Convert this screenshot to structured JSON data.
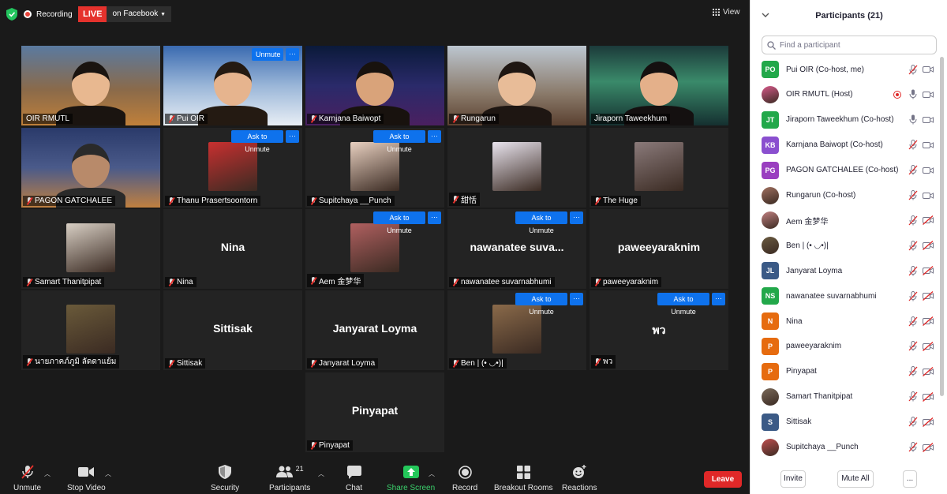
{
  "topbar": {
    "recording_label": "Recording",
    "live_label": "LIVE",
    "live_destination": "on Facebook",
    "view_label": "View"
  },
  "tiles": [
    {
      "name": "OIR RMUTL",
      "muted": false,
      "unmute": "",
      "more": false,
      "type": "video"
    },
    {
      "name": "Pui OIR",
      "muted": true,
      "unmute": "Unmute",
      "more": true,
      "type": "video"
    },
    {
      "name": "Karnjana Baiwopt",
      "muted": true,
      "unmute": "",
      "more": false,
      "type": "video"
    },
    {
      "name": "Rungarun",
      "muted": true,
      "unmute": "",
      "more": false,
      "type": "video"
    },
    {
      "name": "Jiraporn Taweekhum",
      "muted": false,
      "unmute": "",
      "more": false,
      "type": "video"
    },
    {
      "name": "PAGON GATCHALEE",
      "muted": true,
      "unmute": "",
      "more": false,
      "type": "video"
    },
    {
      "name": "Thanu Prasertsoontorn",
      "muted": true,
      "unmute": "Ask to Unmute",
      "more": true,
      "type": "photo"
    },
    {
      "name": "Supitchaya __Punch",
      "muted": true,
      "unmute": "Ask to Unmute",
      "more": true,
      "type": "photo"
    },
    {
      "name": "甜恬",
      "muted": true,
      "unmute": "",
      "more": false,
      "type": "photo"
    },
    {
      "name": "The Huge",
      "muted": true,
      "unmute": "",
      "more": false,
      "type": "photo"
    },
    {
      "name": "Samart Thanitpipat",
      "muted": true,
      "unmute": "",
      "more": false,
      "type": "photo"
    },
    {
      "name": "Nina",
      "muted": true,
      "unmute": "",
      "more": false,
      "type": "text",
      "center": "Nina"
    },
    {
      "name": "Aem 金梦华",
      "muted": true,
      "unmute": "Ask to Unmute",
      "more": true,
      "type": "photo"
    },
    {
      "name": "nawanatee suvarnabhumi",
      "muted": true,
      "unmute": "Ask to Unmute",
      "more": true,
      "type": "text",
      "center": "nawanatee  suva..."
    },
    {
      "name": "paweeyaraknim",
      "muted": true,
      "unmute": "",
      "more": false,
      "type": "text",
      "center": "paweeyaraknim"
    },
    {
      "name": "นายภาคภ์ภูมิ ลัดดาแย้ม",
      "muted": true,
      "unmute": "",
      "more": false,
      "type": "photo"
    },
    {
      "name": "Sittisak",
      "muted": true,
      "unmute": "",
      "more": false,
      "type": "text",
      "center": "Sittisak"
    },
    {
      "name": "Janyarat Loyma",
      "muted": true,
      "unmute": "",
      "more": false,
      "type": "text",
      "center": "Janyarat Loyma"
    },
    {
      "name": "Ben | (• ◡•)|",
      "muted": true,
      "unmute": "Ask to Unmute",
      "more": true,
      "type": "photo"
    },
    {
      "name": "พว",
      "muted": true,
      "unmute": "Ask to Unmute",
      "more": true,
      "type": "text",
      "center": "พว"
    },
    {
      "name": "Pinyapat",
      "muted": true,
      "unmute": "",
      "more": false,
      "type": "text",
      "center": "Pinyapat"
    }
  ],
  "more_glyph": "···",
  "toolbar": {
    "unmute": "Unmute",
    "stop_video": "Stop Video",
    "security": "Security",
    "participants": "Participants",
    "participants_count": "21",
    "chat": "Chat",
    "share_screen": "Share Screen",
    "record": "Record",
    "breakout_rooms": "Breakout Rooms",
    "reactions": "Reactions",
    "leave": "Leave"
  },
  "panel": {
    "title": "Participants (21)",
    "search_placeholder": "Find a participant",
    "participants": [
      {
        "initials": "PO",
        "name": "Pui OIR (Co-host, me)",
        "color": "#22a84a",
        "mic": "muted",
        "video": "on"
      },
      {
        "initials": "",
        "name": "OIR RMUTL (Host)",
        "color": "#d65a8a",
        "mic": "on",
        "video": "on",
        "recording": true
      },
      {
        "initials": "JT",
        "name": "Jiraporn Taweekhum (Co-host)",
        "color": "#22a84a",
        "mic": "on",
        "video": "on"
      },
      {
        "initials": "KB",
        "name": "Karnjana Baiwopt (Co-host)",
        "color": "#8a4fcf",
        "mic": "muted",
        "video": "on"
      },
      {
        "initials": "PG",
        "name": "PAGON GATCHALEE (Co-host)",
        "color": "#9a3fc0",
        "mic": "muted",
        "video": "on"
      },
      {
        "initials": "",
        "name": "Rungarun (Co-host)",
        "color": "#a07060",
        "mic": "muted",
        "video": "on"
      },
      {
        "initials": "",
        "name": "Aem 金梦华",
        "color": "#c08080",
        "mic": "muted",
        "video": "off"
      },
      {
        "initials": "",
        "name": "Ben | (• ◡•)|",
        "color": "#6a5a40",
        "mic": "muted",
        "video": "off"
      },
      {
        "initials": "JL",
        "name": "Janyarat Loyma",
        "color": "#3b5a86",
        "mic": "muted",
        "video": "off"
      },
      {
        "initials": "NS",
        "name": "nawanatee suvarnabhumi",
        "color": "#22a84a",
        "mic": "muted",
        "video": "off"
      },
      {
        "initials": "N",
        "name": "Nina",
        "color": "#e66b0f",
        "mic": "muted",
        "video": "off"
      },
      {
        "initials": "P",
        "name": "paweeyaraknim",
        "color": "#e66b0f",
        "mic": "muted",
        "video": "off"
      },
      {
        "initials": "P",
        "name": "Pinyapat",
        "color": "#e66b0f",
        "mic": "muted",
        "video": "off"
      },
      {
        "initials": "",
        "name": "Samart Thanitpipat",
        "color": "#7a6a5a",
        "mic": "muted",
        "video": "off"
      },
      {
        "initials": "S",
        "name": "Sittisak",
        "color": "#3b5a86",
        "mic": "muted",
        "video": "off"
      },
      {
        "initials": "",
        "name": "Supitchaya __Punch",
        "color": "#c05050",
        "mic": "muted",
        "video": "off"
      }
    ],
    "invite": "Invite",
    "mute_all": "Mute All",
    "more": "..."
  },
  "colors": {
    "accent": "#0e72ed",
    "leave": "#e02828",
    "live": "#e5322d",
    "muted_icon": "#e5322d",
    "speaking_border": "#d6e26a"
  }
}
